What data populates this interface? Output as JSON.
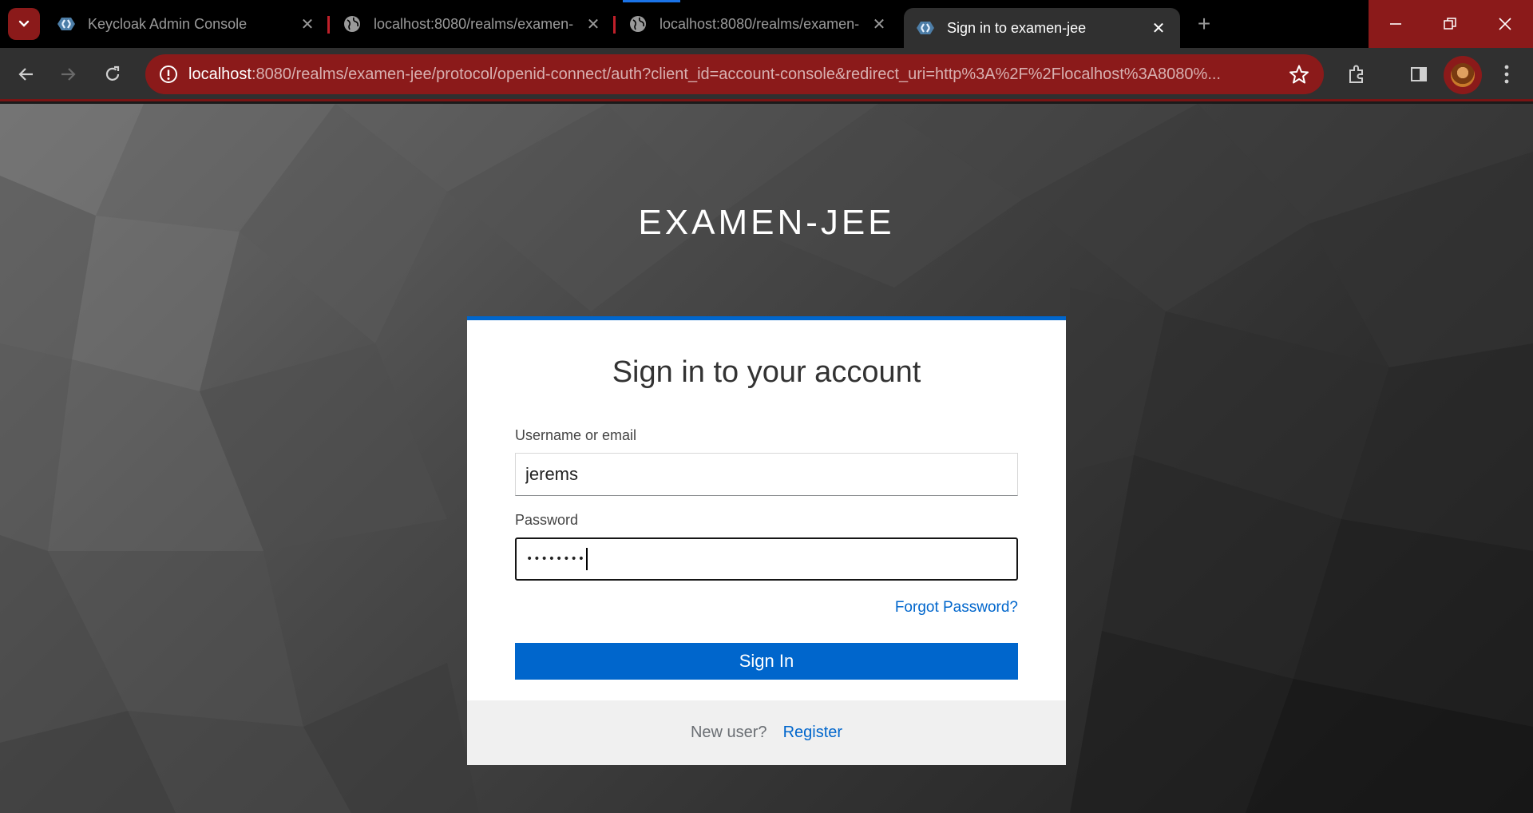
{
  "browser": {
    "tabs": [
      {
        "title": "Keycloak Admin Console",
        "favicon": "keycloak-icon",
        "active": false
      },
      {
        "title": "localhost:8080/realms/examen-",
        "favicon": "globe-icon",
        "active": false
      },
      {
        "title": "localhost:8080/realms/examen-",
        "favicon": "globe-icon",
        "active": false
      },
      {
        "title": "Sign in to examen-jee",
        "favicon": "keycloak-icon",
        "active": true
      }
    ],
    "address_bar": {
      "host": "localhost",
      "rest": ":8080/realms/examen-jee/protocol/openid-connect/auth?client_id=account-console&redirect_uri=http%3A%2F%2Flocalhost%3A8080%..."
    },
    "accent_color": "#8b1a1a"
  },
  "login": {
    "realm_title": "EXAMEN-JEE",
    "heading": "Sign in to your account",
    "username_label": "Username or email",
    "username_value": "jerems",
    "password_label": "Password",
    "password_value": "••••••••",
    "forgot_password": "Forgot Password?",
    "signin_button": "Sign In",
    "new_user_text": "New user?",
    "register_link": "Register",
    "primary_color": "#0066cc"
  }
}
